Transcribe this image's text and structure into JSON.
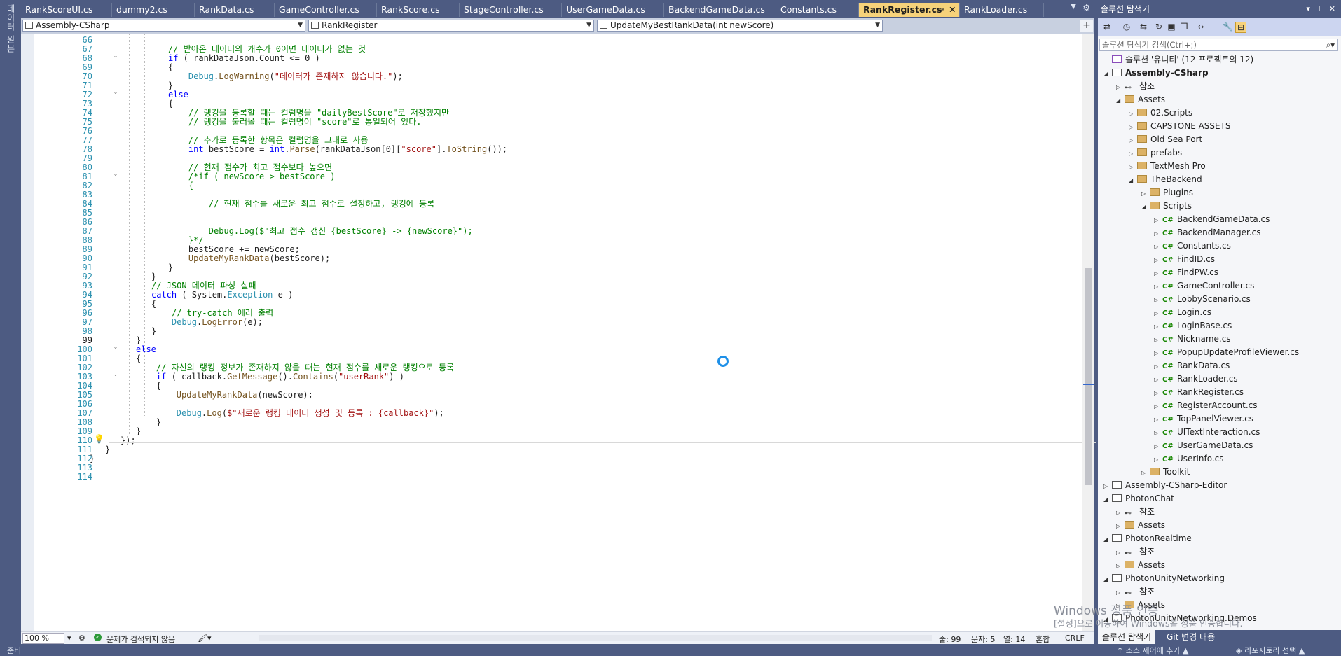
{
  "left_strip": {
    "label": "데이터 원본"
  },
  "tabs": [
    {
      "label": "RankScoreUI.cs"
    },
    {
      "label": "dummy2.cs"
    },
    {
      "label": "RankData.cs"
    },
    {
      "label": "GameController.cs"
    },
    {
      "label": "RankScore.cs"
    },
    {
      "label": "StageController.cs"
    },
    {
      "label": "UserGameData.cs"
    },
    {
      "label": "BackendGameData.cs"
    },
    {
      "label": "Constants.cs"
    },
    {
      "label": "RankRegister.cs",
      "active": true
    },
    {
      "label": "RankLoader.cs"
    }
  ],
  "tab_pin": "⊸",
  "tab_close": "✕",
  "nav": {
    "project": "Assembly-CSharp",
    "class": "RankRegister",
    "member": "UpdateMyBestRankData(int newScore)"
  },
  "code_lines": [
    {
      "n": "66",
      "html": ""
    },
    {
      "n": "67",
      "html": "<span class='cm'>// 받아온 데이터의 개수가 0이면 데이터가 없는 것</span>"
    },
    {
      "n": "68",
      "html": "<span class='kw'>if</span> ( rankDataJson.Count &lt;= 0 )"
    },
    {
      "n": "69",
      "html": "{"
    },
    {
      "n": "70",
      "html": "    <span class='ty'>Debug</span>.<span class='mt'>LogWarning</span>(<span class='st'>\"데이터가 존재하지 않습니다.\"</span>);"
    },
    {
      "n": "71",
      "html": "}"
    },
    {
      "n": "72",
      "html": "<span class='kw'>else</span>"
    },
    {
      "n": "73",
      "html": "{"
    },
    {
      "n": "74",
      "html": "    <span class='cm'>// 랭킹을 등록할 때는 컬럼명을 \"dailyBestScore\"로 저장했지만</span>"
    },
    {
      "n": "75",
      "html": "    <span class='cm'>// 랭킹을 불러올 때는 컬럼명이 \"score\"로 통일되어 있다.</span>"
    },
    {
      "n": "76",
      "html": ""
    },
    {
      "n": "77",
      "html": "    <span class='cm'>// 추가로 등록한 항목은 컬럼명을 그대로 사용</span>"
    },
    {
      "n": "78",
      "html": "    <span class='kw'>int</span> bestScore = <span class='kw'>int</span>.<span class='mt'>Parse</span>(rankDataJson[0][<span class='st'>\"score\"</span>].<span class='mt'>ToString</span>());"
    },
    {
      "n": "79",
      "html": ""
    },
    {
      "n": "80",
      "html": "    <span class='cm'>// 현재 점수가 최고 점수보다 높으면</span>"
    },
    {
      "n": "81",
      "html": "    <span class='cm'>/*if ( newScore &gt; bestScore )</span>"
    },
    {
      "n": "82",
      "html": "    <span class='cm'>{</span>"
    },
    {
      "n": "83",
      "html": ""
    },
    {
      "n": "84",
      "html": "        <span class='cm'>// 현재 점수를 새로운 최고 점수로 설정하고, 랭킹에 등록</span>"
    },
    {
      "n": "85",
      "html": ""
    },
    {
      "n": "86",
      "html": ""
    },
    {
      "n": "87",
      "html": "        <span class='cm'>Debug.Log($\"최고 점수 갱신 {bestScore} -&gt; {newScore}\");</span>"
    },
    {
      "n": "88",
      "html": "    <span class='cm'>}*/</span>"
    },
    {
      "n": "89",
      "html": "    bestScore += newScore;"
    },
    {
      "n": "90",
      "html": "    <span class='mt'>UpdateMyRankData</span>(bestScore);"
    },
    {
      "n": "91",
      "html": "}"
    },
    {
      "n": "92",
      "html": "}"
    },
    {
      "n": "93",
      "html": "<span class='cm'>// JSON 데이터 파싱 실패</span>"
    },
    {
      "n": "94",
      "html": "<span class='kw'>catch</span> ( System.<span class='ty'>Exception</span> e )"
    },
    {
      "n": "95",
      "html": "{"
    },
    {
      "n": "96",
      "html": "    <span class='cm'>// try-catch 에러 출력</span>"
    },
    {
      "n": "97",
      "html": "    <span class='ty'>Debug</span>.<span class='mt'>LogError</span>(e);"
    },
    {
      "n": "98",
      "html": "}"
    },
    {
      "n": "99",
      "html": "}"
    },
    {
      "n": "100",
      "html": "<span class='kw'>else</span>"
    },
    {
      "n": "101",
      "html": "{"
    },
    {
      "n": "102",
      "html": "    <span class='cm'>// 자신의 랭킹 정보가 존재하지 않을 때는 현재 점수를 새로운 랭킹으로 등록</span>"
    },
    {
      "n": "103",
      "html": "    <span class='kw'>if</span> ( callback.<span class='mt'>GetMessage</span>().<span class='mt'>Contains</span>(<span class='st'>\"userRank\"</span>) )"
    },
    {
      "n": "104",
      "html": "    {"
    },
    {
      "n": "105",
      "html": "        <span class='mt'>UpdateMyRankData</span>(newScore);"
    },
    {
      "n": "106",
      "html": ""
    },
    {
      "n": "107",
      "html": "        <span class='ty'>Debug</span>.<span class='mt'>Log</span>(<span class='st'>$\"새로운 랭킹 데이터 생성 및 등록 : {callback}\"</span>);"
    },
    {
      "n": "108",
      "html": "    }"
    },
    {
      "n": "109",
      "html": "}"
    },
    {
      "n": "110",
      "html": "});"
    },
    {
      "n": "111",
      "html": "}"
    },
    {
      "n": "112",
      "html": "}"
    },
    {
      "n": "113",
      "html": ""
    },
    {
      "n": "114",
      "html": ""
    }
  ],
  "editor_status": {
    "zoom": "100 %",
    "issues": "문제가 검색되지 않음",
    "line": "줄: 99",
    "char": "문자: 5",
    "col": "열: 14",
    "mixed": "혼합",
    "crlf": "CRLF"
  },
  "solution_explorer": {
    "title": "솔루션 탐색기",
    "search_placeholder": "솔루션 탐색기 검색(Ctrl+;)",
    "tree": [
      {
        "label": "솔루션 '유니티' (12 프로젝트의 12)",
        "icon": "sol",
        "level": 0,
        "tri": ""
      },
      {
        "label": "Assembly-CSharp",
        "icon": "proj",
        "level": 0,
        "tri": "◢",
        "bold": true
      },
      {
        "label": "참조",
        "icon": "ref",
        "level": 1,
        "tri": "▷"
      },
      {
        "label": "Assets",
        "icon": "folder",
        "level": 1,
        "tri": "◢"
      },
      {
        "label": "02.Scripts",
        "icon": "folder",
        "level": 2,
        "tri": "▷"
      },
      {
        "label": "CAPSTONE ASSETS",
        "icon": "folder",
        "level": 2,
        "tri": "▷"
      },
      {
        "label": "Old Sea Port",
        "icon": "folder",
        "level": 2,
        "tri": "▷"
      },
      {
        "label": "prefabs",
        "icon": "folder",
        "level": 2,
        "tri": "▷"
      },
      {
        "label": "TextMesh Pro",
        "icon": "folder",
        "level": 2,
        "tri": "▷"
      },
      {
        "label": "TheBackend",
        "icon": "folder",
        "level": 2,
        "tri": "◢"
      },
      {
        "label": "Plugins",
        "icon": "folder",
        "level": 3,
        "tri": "▷"
      },
      {
        "label": "Scripts",
        "icon": "folder",
        "level": 3,
        "tri": "◢"
      },
      {
        "label": "BackendGameData.cs",
        "icon": "cs",
        "level": 4,
        "tri": "▷"
      },
      {
        "label": "BackendManager.cs",
        "icon": "cs",
        "level": 4,
        "tri": "▷"
      },
      {
        "label": "Constants.cs",
        "icon": "cs",
        "level": 4,
        "tri": "▷"
      },
      {
        "label": "FindID.cs",
        "icon": "cs",
        "level": 4,
        "tri": "▷"
      },
      {
        "label": "FindPW.cs",
        "icon": "cs",
        "level": 4,
        "tri": "▷"
      },
      {
        "label": "GameController.cs",
        "icon": "cs",
        "level": 4,
        "tri": "▷"
      },
      {
        "label": "LobbyScenario.cs",
        "icon": "cs",
        "level": 4,
        "tri": "▷"
      },
      {
        "label": "Login.cs",
        "icon": "cs",
        "level": 4,
        "tri": "▷"
      },
      {
        "label": "LoginBase.cs",
        "icon": "cs",
        "level": 4,
        "tri": "▷"
      },
      {
        "label": "Nickname.cs",
        "icon": "cs",
        "level": 4,
        "tri": "▷"
      },
      {
        "label": "PopupUpdateProfileViewer.cs",
        "icon": "cs",
        "level": 4,
        "tri": "▷"
      },
      {
        "label": "RankData.cs",
        "icon": "cs",
        "level": 4,
        "tri": "▷"
      },
      {
        "label": "RankLoader.cs",
        "icon": "cs",
        "level": 4,
        "tri": "▷"
      },
      {
        "label": "RankRegister.cs",
        "icon": "cs",
        "level": 4,
        "tri": "▷"
      },
      {
        "label": "RegisterAccount.cs",
        "icon": "cs",
        "level": 4,
        "tri": "▷"
      },
      {
        "label": "TopPanelViewer.cs",
        "icon": "cs",
        "level": 4,
        "tri": "▷"
      },
      {
        "label": "UITextInteraction.cs",
        "icon": "cs",
        "level": 4,
        "tri": "▷"
      },
      {
        "label": "UserGameData.cs",
        "icon": "cs",
        "level": 4,
        "tri": "▷"
      },
      {
        "label": "UserInfo.cs",
        "icon": "cs",
        "level": 4,
        "tri": "▷"
      },
      {
        "label": "Toolkit",
        "icon": "folder",
        "level": 3,
        "tri": "▷"
      },
      {
        "label": "Assembly-CSharp-Editor",
        "icon": "proj",
        "level": 0,
        "tri": "▷"
      },
      {
        "label": "PhotonChat",
        "icon": "proj",
        "level": 0,
        "tri": "◢"
      },
      {
        "label": "참조",
        "icon": "ref",
        "level": 1,
        "tri": "▷"
      },
      {
        "label": "Assets",
        "icon": "folder",
        "level": 1,
        "tri": "▷"
      },
      {
        "label": "PhotonRealtime",
        "icon": "proj",
        "level": 0,
        "tri": "◢"
      },
      {
        "label": "참조",
        "icon": "ref",
        "level": 1,
        "tri": "▷"
      },
      {
        "label": "Assets",
        "icon": "folder",
        "level": 1,
        "tri": "▷"
      },
      {
        "label": "PhotonUnityNetworking",
        "icon": "proj",
        "level": 0,
        "tri": "◢"
      },
      {
        "label": "참조",
        "icon": "ref",
        "level": 1,
        "tri": "▷"
      },
      {
        "label": "Assets",
        "icon": "folder",
        "level": 1,
        "tri": "▷"
      },
      {
        "label": "PhotonUnityNetworking.Demos",
        "icon": "proj",
        "level": 0,
        "tri": "◢"
      }
    ],
    "bottom_tabs": [
      "솔루션 탐색기",
      "Git 변경 내용"
    ]
  },
  "watermark": {
    "line1": "Windows 정품 인증",
    "line2": "[설정]으로 이동하여 Windows를 정품 인증합니다."
  },
  "bottom_bar": {
    "left": "준비",
    "center": "↑ 소스 제어에 추가 ▲",
    "right": "◈ 리포지토리 선택 ▲"
  }
}
